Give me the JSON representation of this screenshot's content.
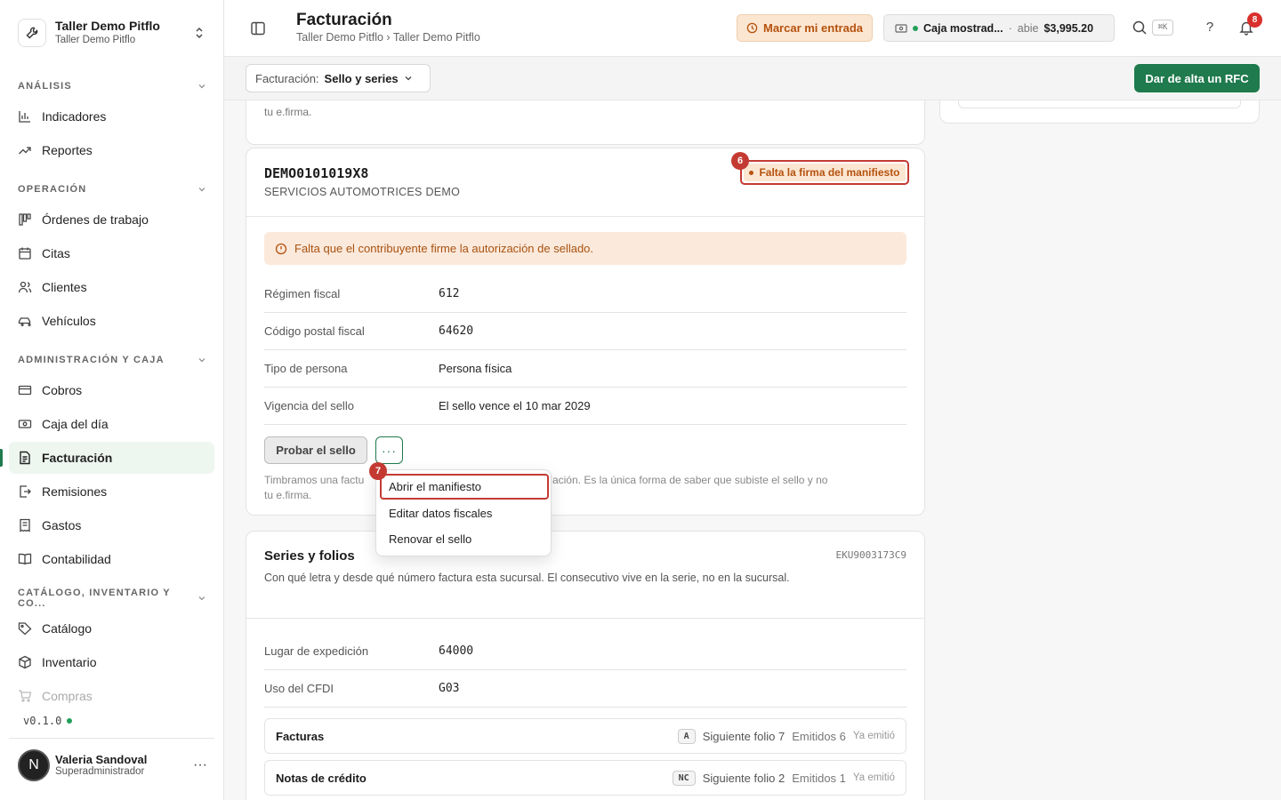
{
  "workspace": {
    "title": "Taller Demo Pitflo",
    "subtitle": "Taller Demo Pitflo"
  },
  "sidebar": {
    "sections": [
      {
        "label": "ANÁLISIS"
      },
      {
        "label": "OPERACIÓN"
      },
      {
        "label": "ADMINISTRACIÓN Y CAJA"
      },
      {
        "label": "CATÁLOGO, INVENTARIO Y CO..."
      }
    ],
    "items": [
      {
        "label": "Indicadores",
        "icon": "bar-chart-icon"
      },
      {
        "label": "Reportes",
        "icon": "trend-icon"
      },
      {
        "label": "Órdenes de trabajo",
        "icon": "kanban-icon"
      },
      {
        "label": "Citas",
        "icon": "calendar-icon"
      },
      {
        "label": "Clientes",
        "icon": "users-icon"
      },
      {
        "label": "Vehículos",
        "icon": "car-icon"
      },
      {
        "label": "Cobros",
        "icon": "card-icon"
      },
      {
        "label": "Caja del día",
        "icon": "cash-icon"
      },
      {
        "label": "Facturación",
        "icon": "invoice-icon"
      },
      {
        "label": "Remisiones",
        "icon": "export-icon"
      },
      {
        "label": "Gastos",
        "icon": "receipt-icon"
      },
      {
        "label": "Contabilidad",
        "icon": "book-icon"
      },
      {
        "label": "Catálogo",
        "icon": "tag-icon"
      },
      {
        "label": "Inventario",
        "icon": "box-icon"
      },
      {
        "label": "Compras",
        "icon": "cart-icon"
      }
    ],
    "version": "v0.1.0",
    "user": {
      "initial": "N",
      "name": "Valeria Sandoval",
      "role": "Superadministrador"
    }
  },
  "header": {
    "title": "Facturación",
    "breadcrumb": "Taller Demo Pitflo › Taller Demo Pitflo",
    "mark_entry": "Marcar mi entrada",
    "register_name": "Caja mostrad...",
    "register_sep": "·",
    "register_state": "abie",
    "register_amount": "$3,995.20",
    "search_shortcut": "⌘K",
    "help": "?",
    "notifications_count": "8"
  },
  "toolbar": {
    "filter_label": "Facturación:",
    "filter_value": "Sello y series",
    "add_rfc": "Dar de alta un RFC"
  },
  "top_card_text": "tu e.firma.",
  "rfc_card": {
    "rfc": "DEMO0101019X8",
    "name": "SERVICIOS AUTOMOTRICES DEMO",
    "status": "Falta la firma del manifiesto",
    "marker_status": "6",
    "alert": "Falta que el contribuyente firme la autorización de sellado.",
    "rows": [
      {
        "label": "Régimen fiscal",
        "value": "612"
      },
      {
        "label": "Código postal fiscal",
        "value": "64620"
      },
      {
        "label": "Tipo de persona",
        "value": "Persona física"
      },
      {
        "label": "Vigencia del sello",
        "value": "El sello vence el 10 mar 2029"
      }
    ],
    "test_button": "Probar el sello",
    "more_button": "···",
    "note_start": "Timbramos una factu",
    "note_end": "os su cancelación. Es la única forma de saber que subiste el sello y no",
    "note_line2": "tu e.firma."
  },
  "menu": {
    "marker": "7",
    "items": [
      "Abrir el manifiesto",
      "Editar datos fiscales",
      "Renovar el sello"
    ]
  },
  "series_card": {
    "title": "Series y folios",
    "code": "EKU9003173C9",
    "description": "Con qué letra y desde qué número factura esta sucursal. El consecutivo vive en la serie, no en la sucursal.",
    "rows": [
      {
        "label": "Lugar de expedición",
        "value": "64000"
      },
      {
        "label": "Uso del CFDI",
        "value": "G03"
      }
    ],
    "series": [
      {
        "name": "Facturas",
        "code": "A",
        "next": "Siguiente folio 7",
        "issued": "Emitidos 6",
        "status": "Ya emitió"
      },
      {
        "name": "Notas de crédito",
        "code": "NC",
        "next": "Siguiente folio 2",
        "issued": "Emitidos 1",
        "status": "Ya emitió"
      }
    ]
  },
  "colors": {
    "brand": "#1f7a4d",
    "warning_bg": "#fbe6d2",
    "warning_text": "#b5520e",
    "marker": "#c43a32"
  }
}
